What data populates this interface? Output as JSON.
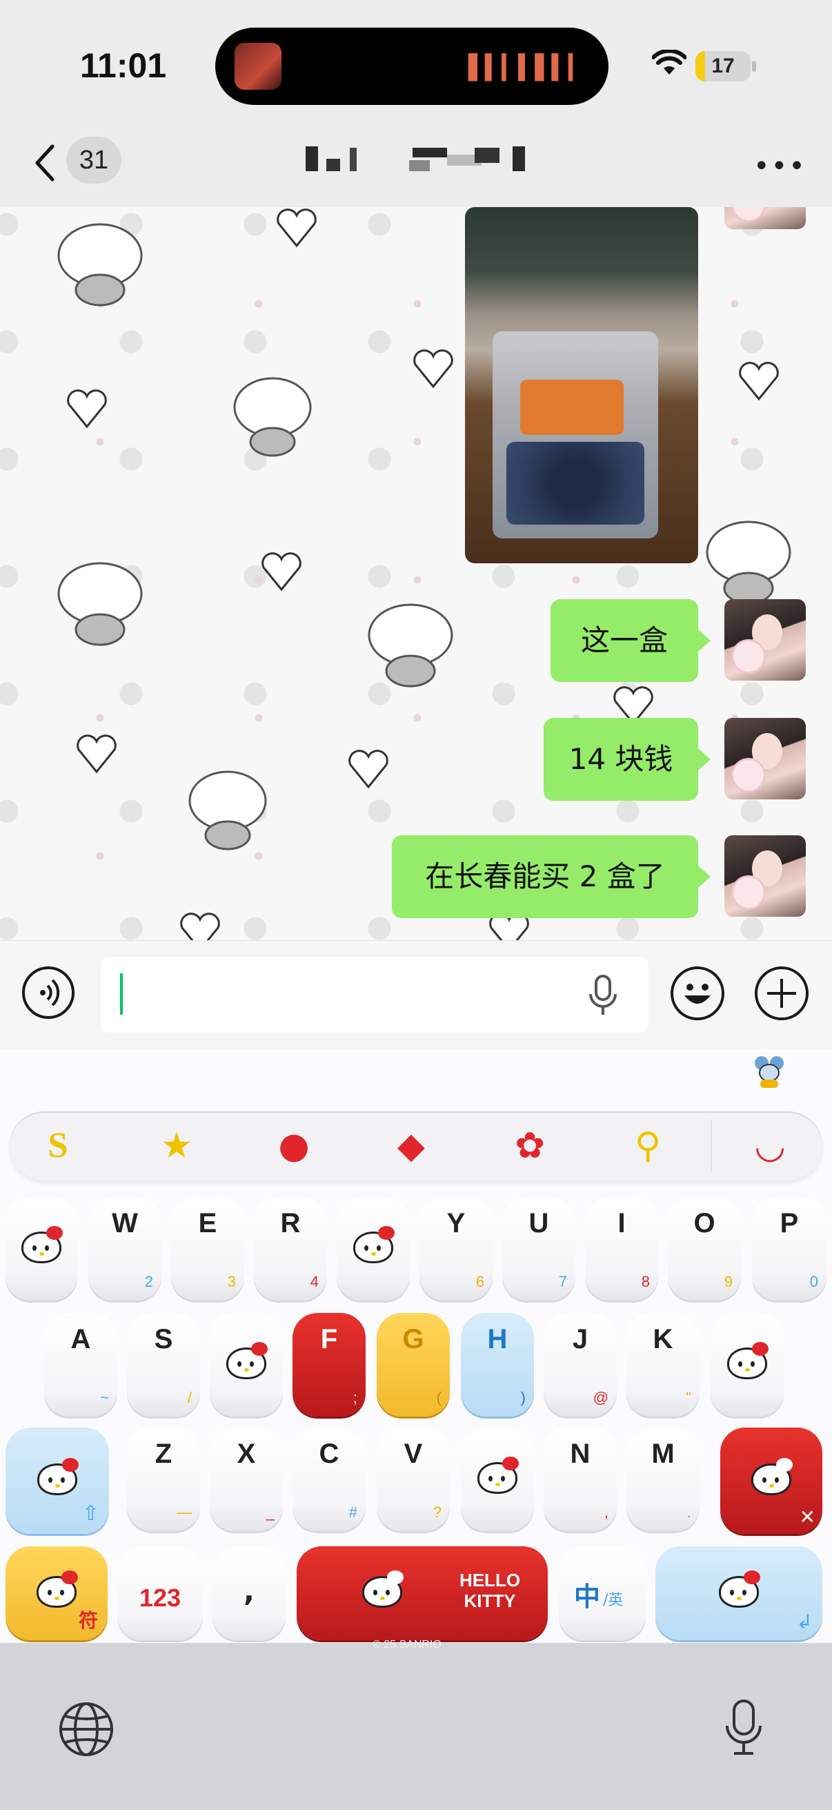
{
  "status_bar": {
    "time": "11:01",
    "battery_level": "17",
    "battery_fraction": 0.17
  },
  "nav": {
    "unread_count": "31",
    "title": "▮▖▮ ▀▀▚▘▮"
  },
  "messages": [
    {
      "type": "image",
      "sender": "me",
      "description_icon": "photo-of-blueberries"
    },
    {
      "type": "text",
      "sender": "me",
      "text": "这一盒"
    },
    {
      "type": "text",
      "sender": "me",
      "text": "14 块钱"
    },
    {
      "type": "text",
      "sender": "me",
      "text": "在长春能买 2 盒了"
    }
  ],
  "input": {
    "value": "",
    "placeholder": ""
  },
  "keyboard": {
    "toolbar_icons": [
      "s-icon",
      "star-icon",
      "hello-kitty-apple-icon",
      "dice-icon",
      "flower-icon",
      "search-icon",
      "bowl-icon"
    ],
    "row1": [
      {
        "letter": "",
        "sub": "",
        "kitty": true
      },
      {
        "letter": "W",
        "sub": "2",
        "sub_color": "#4aa7e8"
      },
      {
        "letter": "E",
        "sub": "3",
        "sub_color": "#f0b400"
      },
      {
        "letter": "R",
        "sub": "4",
        "sub_color": "#e0262b"
      },
      {
        "letter": "",
        "sub": "",
        "kitty": true
      },
      {
        "letter": "Y",
        "sub": "6",
        "sub_color": "#f0b400"
      },
      {
        "letter": "U",
        "sub": "7",
        "sub_color": "#4aa7e8"
      },
      {
        "letter": "I",
        "sub": "8",
        "sub_color": "#e0262b"
      },
      {
        "letter": "O",
        "sub": "9",
        "sub_color": "#f0b400"
      },
      {
        "letter": "P",
        "sub": "0",
        "sub_color": "#4aa7e8"
      }
    ],
    "row2": [
      {
        "letter": "A",
        "sub": "~",
        "sub_color": "#4aa7e8"
      },
      {
        "letter": "S",
        "sub": "/",
        "sub_color": "#f0b400"
      },
      {
        "letter": "",
        "sub": "",
        "kitty": true
      },
      {
        "letter": "F",
        "sub": ";",
        "sub_color": "#ffffff",
        "style": "red"
      },
      {
        "letter": "G",
        "sub": "(",
        "sub_color": "#c98a00",
        "style": "yellow"
      },
      {
        "letter": "H",
        "sub": ")",
        "sub_color": "#1e77c8",
        "style": "blue"
      },
      {
        "letter": "J",
        "sub": "@",
        "sub_color": "#e0262b"
      },
      {
        "letter": "K",
        "sub": "\"",
        "sub_color": "#f0b400"
      },
      {
        "letter": "",
        "sub": "",
        "kitty": true
      }
    ],
    "row3": [
      {
        "letter": "Z",
        "sub": "—",
        "sub_color": "#f0b400"
      },
      {
        "letter": "X",
        "sub": "_",
        "sub_color": "#e0262b"
      },
      {
        "letter": "C",
        "sub": "#",
        "sub_color": "#4aa7e8"
      },
      {
        "letter": "V",
        "sub": "?",
        "sub_color": "#f0b400"
      },
      {
        "letter": "",
        "sub": "",
        "kitty": true
      },
      {
        "letter": "N",
        "sub": ",",
        "sub_color": "#e0262b"
      },
      {
        "letter": "M",
        "sub": ".",
        "sub_color": "#4aa7e8"
      }
    ],
    "symbols_label": "符",
    "numbers_label": "123",
    "comma_label": ",",
    "space_brand": "HELLO KITTY",
    "lang_primary": "中",
    "lang_secondary": "/英",
    "copyright": "© 25 SANRIO"
  },
  "colors": {
    "bubble": "#95ec69",
    "accent": "#07c160"
  }
}
